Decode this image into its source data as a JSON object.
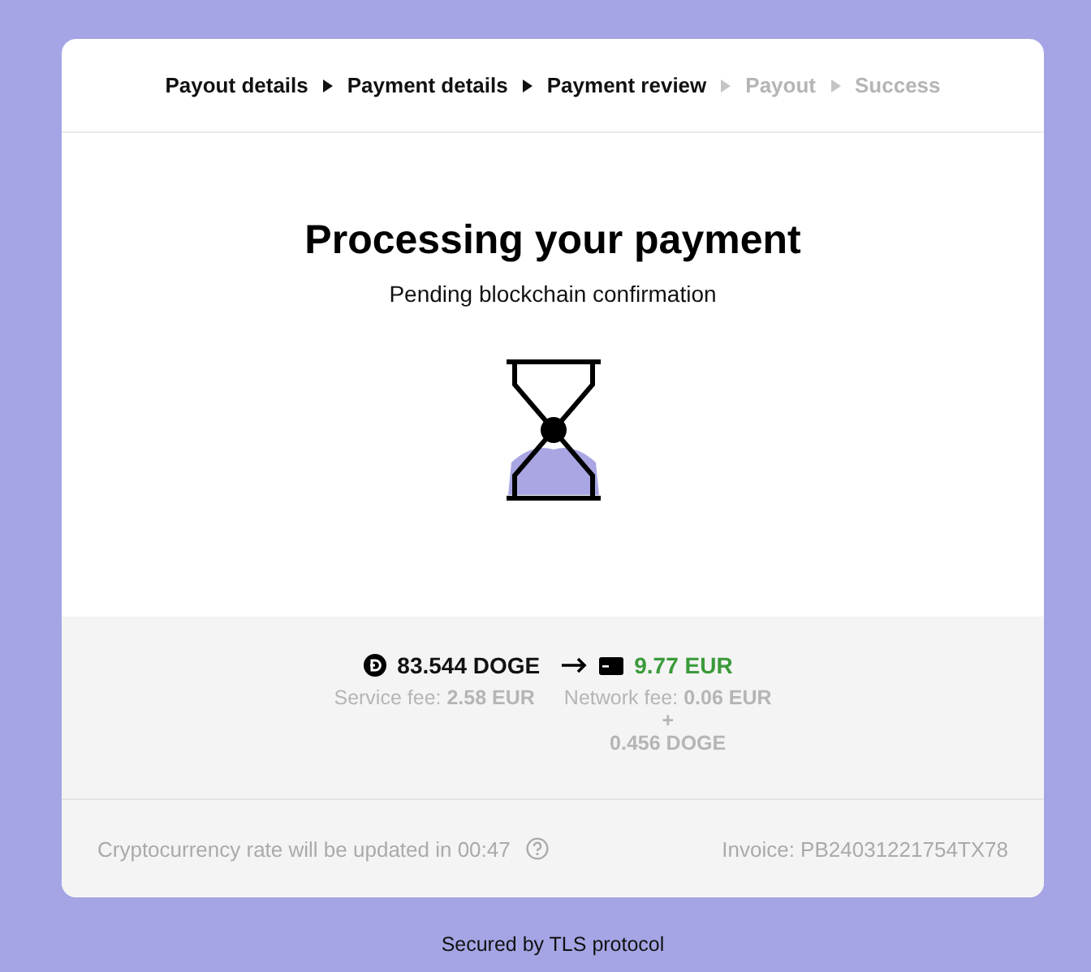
{
  "steps": [
    {
      "label": "Payout details",
      "completed": true
    },
    {
      "label": "Payment details",
      "completed": true
    },
    {
      "label": "Payment review",
      "completed": true
    },
    {
      "label": "Payout",
      "completed": false
    },
    {
      "label": "Success",
      "completed": false
    }
  ],
  "title": "Processing your payment",
  "subtitle": "Pending blockchain confirmation",
  "conversion": {
    "from": "83.544 DOGE",
    "to": "9.77 EUR"
  },
  "service_fee": {
    "label": "Service fee:",
    "amount": "2.58 EUR"
  },
  "network_fee": {
    "label": "Network fee:",
    "amount": "0.06 EUR",
    "plus": "+",
    "extra": "0.456 DOGE"
  },
  "rate_notice": "Cryptocurrency rate will be updated in 00:47",
  "invoice": "Invoice: PB24031221754TX78",
  "footer": "Secured by TLS protocol"
}
